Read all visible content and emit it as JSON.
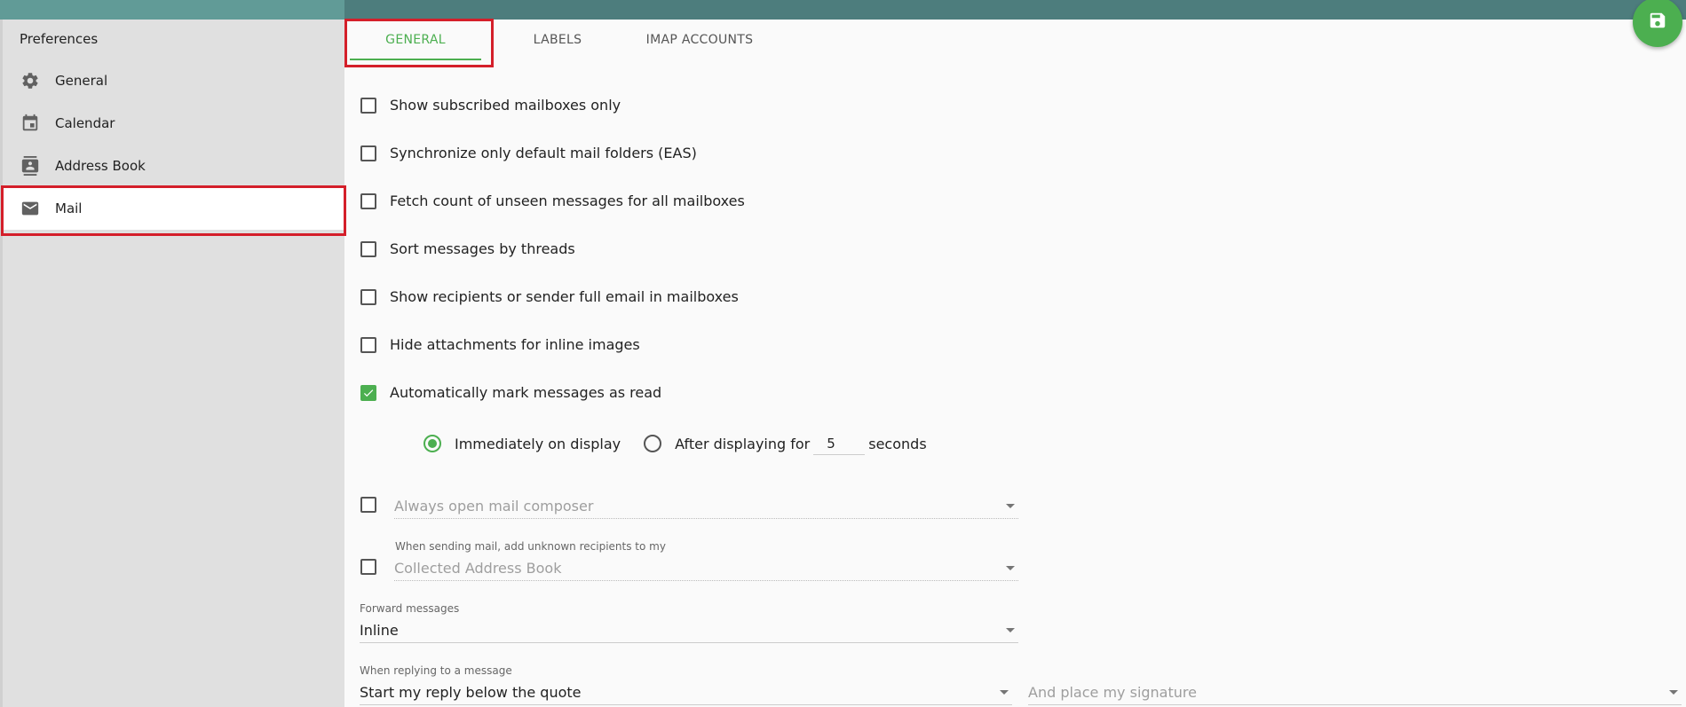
{
  "sidebar": {
    "title": "Preferences",
    "items": [
      {
        "label": "General",
        "icon": "gear-icon"
      },
      {
        "label": "Calendar",
        "icon": "calendar-icon"
      },
      {
        "label": "Address Book",
        "icon": "contacts-icon"
      },
      {
        "label": "Mail",
        "icon": "mail-icon",
        "active": true
      }
    ]
  },
  "tabs": [
    {
      "label": "GENERAL",
      "active": true
    },
    {
      "label": "LABELS"
    },
    {
      "label": "IMAP ACCOUNTS"
    }
  ],
  "fab": {
    "icon": "save-icon"
  },
  "options": [
    {
      "label": "Show subscribed mailboxes only",
      "checked": false
    },
    {
      "label": "Synchronize only default mail folders (EAS)",
      "checked": false
    },
    {
      "label": "Fetch count of unseen messages for all mailboxes",
      "checked": false
    },
    {
      "label": "Sort messages by threads",
      "checked": false
    },
    {
      "label": "Show recipients or sender full email in mailboxes",
      "checked": false
    },
    {
      "label": "Hide attachments for inline images",
      "checked": false
    },
    {
      "label": "Automatically mark messages as read",
      "checked": true
    }
  ],
  "mark_read": {
    "immediately_label": "Immediately on display",
    "after_label": "After displaying for",
    "seconds_value": "5",
    "seconds_label": "seconds",
    "selected": "immediately"
  },
  "composer": {
    "checked": false,
    "placeholder": "Always open mail composer"
  },
  "collect": {
    "checked": false,
    "label": "When sending mail, add unknown recipients to my",
    "value": "Collected Address Book"
  },
  "forward": {
    "label": "Forward messages",
    "value": "Inline"
  },
  "reply": {
    "label": "When replying to a message",
    "value": "Start my reply below the quote",
    "signature_placeholder": "And place my signature"
  },
  "colors": {
    "accent": "#4caf50",
    "topbar": "#4d7d7d",
    "highlight": "#d41f2a"
  }
}
